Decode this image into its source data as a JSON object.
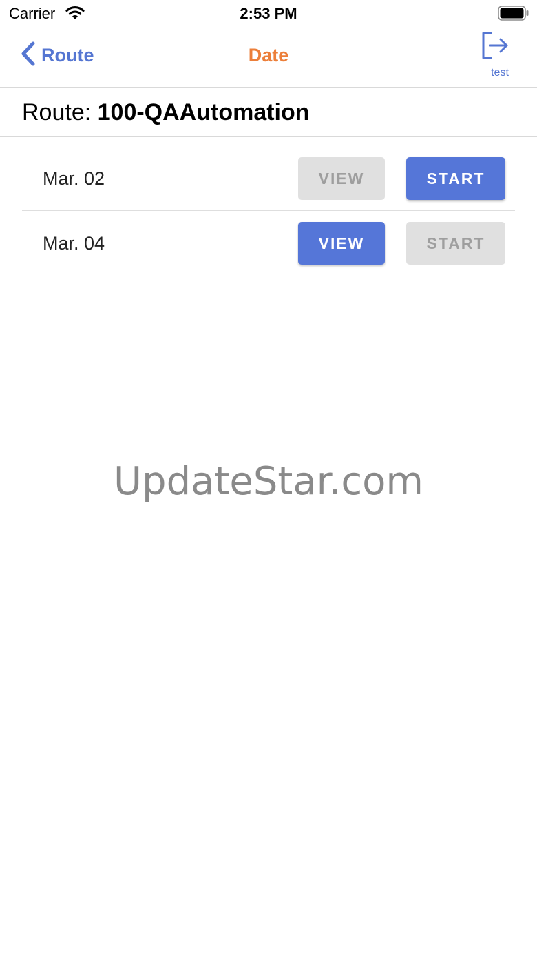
{
  "status_bar": {
    "carrier": "Carrier",
    "time": "2:53 PM",
    "wifi_icon": "wifi-icon",
    "battery_icon": "battery-icon"
  },
  "nav": {
    "back_label": "Route",
    "back_icon": "chevron-left-icon",
    "title": "Date",
    "logout_icon": "logout-icon",
    "user_label": "test"
  },
  "route_header": {
    "prefix": "Route: ",
    "name": "100-QAAutomation"
  },
  "dates": [
    {
      "label": "Mar. 02",
      "view_label": "VIEW",
      "view_enabled": false,
      "start_label": "START",
      "start_enabled": true
    },
    {
      "label": "Mar. 04",
      "view_label": "VIEW",
      "view_enabled": true,
      "start_label": "START",
      "start_enabled": false
    }
  ],
  "watermark": "UpdateStar.com",
  "colors": {
    "accent_blue": "#5576d8",
    "title_orange": "#ec7f3a",
    "disabled_bg": "#e0e0e0",
    "disabled_text": "#9e9e9e"
  }
}
